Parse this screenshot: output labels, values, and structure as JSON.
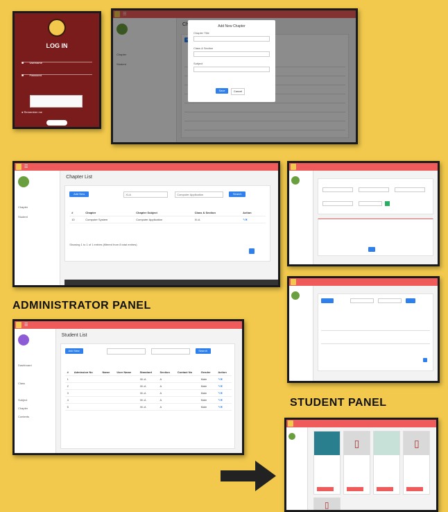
{
  "headings": {
    "admin": "ADMINISTRATOR PANEL",
    "student": "STUDENT PANEL"
  },
  "login": {
    "title": "LOG IN",
    "username_label": "Username",
    "password_label": "Password",
    "remember": "Remember me"
  },
  "chapter_modal": {
    "page_title": "Chapter List",
    "modal_title": "Add New Chapter",
    "fields": [
      "Chapter Title",
      "Class & Section",
      "Subject"
    ],
    "save": "Save",
    "cancel": "Cancel"
  },
  "chapter_list": {
    "title": "Chapter List",
    "add_btn": "Add New",
    "filter_class": "XI-A",
    "filter_subject": "Computer Application",
    "search_btn": "Search",
    "columns": [
      "#",
      "Chapter",
      "Chapter Subject",
      "Class & Section",
      "Action"
    ],
    "rows": [
      [
        "10",
        "Computer System",
        "Computer Application",
        "XI-A",
        ""
      ]
    ],
    "footer_info": "Showing 1 to 1 of 1 entries (filtered from 8 total entries)"
  },
  "student_list": {
    "title": "Student List",
    "add_btn": "Add New",
    "search_btn": "Search",
    "columns": [
      "#",
      "Admission No",
      "Name",
      "User Name",
      "Standard",
      "Section",
      "Contact No",
      "Gender",
      "Action"
    ],
    "rows": [
      [
        "1",
        "",
        "",
        "",
        "XII-A",
        "A",
        "",
        "Male",
        ""
      ],
      [
        "2",
        "",
        "",
        "",
        "XII-A",
        "A",
        "",
        "Male",
        ""
      ],
      [
        "3",
        "",
        "",
        "",
        "XII-A",
        "A",
        "",
        "Male",
        ""
      ],
      [
        "4",
        "",
        "",
        "",
        "XII-A",
        "A",
        "",
        "Male",
        ""
      ],
      [
        "5",
        "",
        "",
        "",
        "XII-A",
        "A",
        "",
        "Male",
        ""
      ]
    ]
  },
  "nav": {
    "chapter": "Chapter",
    "student": "Student",
    "dashboard": "Dashboard",
    "class": "Class",
    "subject": "Subject",
    "contents": "Contents"
  }
}
